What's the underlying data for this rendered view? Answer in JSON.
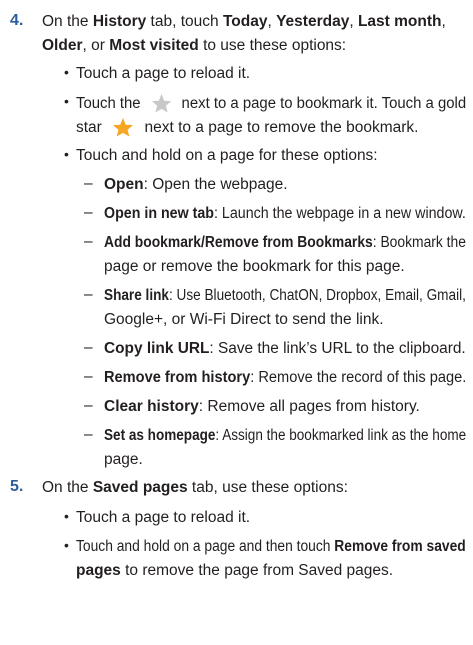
{
  "steps": [
    {
      "number": "4.",
      "lines": [
        [
          "On the ",
          "History",
          " tab, touch ",
          "Today",
          ", ",
          "Yesterday",
          ", ",
          "Last month",
          ","
        ],
        [
          "Older",
          ", or ",
          "Most visited",
          " to use these options:"
        ]
      ],
      "bullets": [
        {
          "text": "Touch a page to reload it."
        },
        {
          "line1_pre": "Touch the",
          "line1_post": "next to a page to bookmark it. Touch a gold",
          "line2_pre": "star",
          "line2_post": "next to a page to remove the bookmark."
        },
        {
          "text": "Touch and hold on a page for these options:"
        }
      ],
      "options": [
        {
          "term": "Open",
          "desc": ": Open the webpage."
        },
        {
          "term": "Open in new tab",
          "desc": ": Launch the webpage in a new window."
        },
        {
          "term": "Add bookmark/Remove from Bookmarks",
          "desc": ": Bookmark the",
          "cont": "page or remove the bookmark for this page."
        },
        {
          "term": "Share link",
          "desc": ": Use Bluetooth, ChatON, Dropbox, Email, Gmail,",
          "cont": "Google+, or Wi-Fi Direct to send the link."
        },
        {
          "term": "Copy link URL",
          "desc": ": Save the link’s URL to the clipboard."
        },
        {
          "term": "Remove from history",
          "desc": ": Remove the record of this page."
        },
        {
          "term": "Clear history",
          "desc": ": Remove all pages from history."
        },
        {
          "term": "Set as homepage",
          "desc": ": Assign the bookmarked link as the home",
          "cont": "page."
        }
      ]
    },
    {
      "number": "5.",
      "intro": [
        "On the ",
        "Saved pages",
        " tab, use these options:"
      ],
      "bullets": [
        {
          "text": "Touch a page to reload it."
        },
        {
          "pre": "Touch and hold on a page and then touch ",
          "term": "Remove from saved",
          "term2": "pages",
          "post": " to remove the page from Saved pages."
        }
      ]
    }
  ],
  "icons": {
    "grey_star": "star-outline-icon",
    "gold_star": "star-gold-icon",
    "grey_color": "#c6c8ca",
    "gold_color": "#f6a623",
    "number_color": "#2b5c9c"
  },
  "bullet_char": "•",
  "dash_char": "–"
}
